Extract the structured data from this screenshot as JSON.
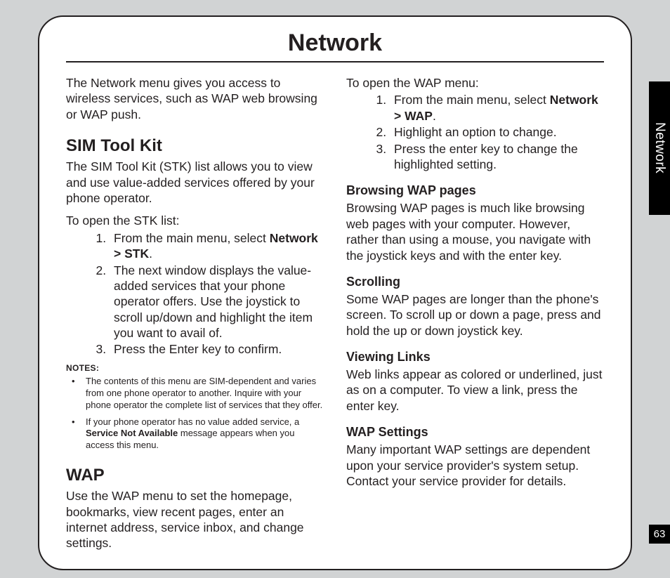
{
  "title": "Network",
  "sideTab": "Network",
  "pageNumber": "63",
  "left": {
    "intro": "The Network menu gives you access to wireless services, such as WAP web browsing or WAP push.",
    "stk": {
      "heading": "SIM Tool Kit",
      "body": "The SIM Tool Kit (STK) list allows you to view and use value-added services offered by your phone operator.",
      "lead": "To open the STK list:",
      "step1a": "From the main menu, select ",
      "step1b": "Network > STK",
      "step1c": ".",
      "step2": "The next window displays the value-added services that your phone operator offers. Use the joystick to scroll up/down and highlight the item you want to avail of.",
      "step3": "Press the Enter key to confirm."
    },
    "notesLabel": "NOTES:",
    "note1": "The contents of this menu are SIM-dependent and varies from one phone operator to another. Inquire with your phone operator the complete list of services that they offer.",
    "note2a": "If your phone operator has no value added service, a ",
    "note2b": "Service Not Available",
    "note2c": " message appears when you access this menu.",
    "wap": {
      "heading": "WAP",
      "body": "Use the WAP menu to set the homepage, bookmarks, view recent pages, enter an internet address, service inbox, and change settings."
    }
  },
  "right": {
    "lead": "To open the WAP menu:",
    "step1a": "From the main menu, select ",
    "step1b": "Network > WAP",
    "step1c": ".",
    "step2": "Highlight an option to change.",
    "step3": "Press the enter key to change the highlighted setting.",
    "browsing": {
      "heading": "Browsing WAP pages",
      "body": "Browsing WAP pages is much like browsing web pages with your computer. However, rather than using a mouse, you navigate with the joystick keys and with the enter key."
    },
    "scrolling": {
      "heading": "Scrolling",
      "body": "Some WAP pages are longer than the phone's screen. To scroll up or down a page, press and hold the up or down joystick key."
    },
    "links": {
      "heading": "Viewing Links",
      "body": "Web links appear as colored or underlined, just as on a computer. To view a link, press the enter key."
    },
    "settings": {
      "heading": "WAP Settings",
      "body": "Many important WAP settings are dependent upon your service provider's system setup. Contact your service provider for details."
    }
  }
}
